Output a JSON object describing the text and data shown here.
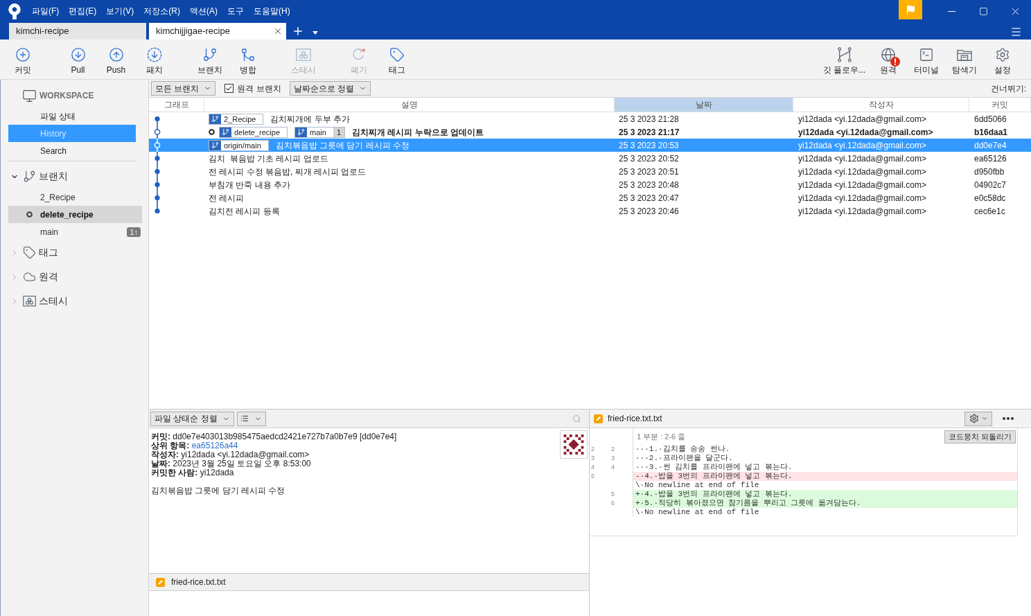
{
  "window": {
    "menu": [
      "파일(F)",
      "편집(E)",
      "보기(V)",
      "저장소(R)",
      "액션(A)",
      "도구",
      "도움말(H)"
    ]
  },
  "repo_tabs": [
    {
      "label": "kimchi-recipe",
      "selected": false
    },
    {
      "label": "kimchijjigae-recipe",
      "selected": true
    }
  ],
  "toolbar": {
    "left_groups": [
      {
        "buttons": [
          {
            "label": "커밋",
            "disabled": false
          }
        ]
      },
      {
        "buttons": [
          {
            "label": "Pull",
            "disabled": false
          },
          {
            "label": "Push",
            "disabled": false
          },
          {
            "label": "패치",
            "disabled": false
          }
        ]
      },
      {
        "buttons": [
          {
            "label": "브랜치",
            "disabled": false
          },
          {
            "label": "병합",
            "disabled": false
          }
        ]
      },
      {
        "buttons": [
          {
            "label": "스테시",
            "disabled": true
          }
        ]
      },
      {
        "buttons": [
          {
            "label": "폐기",
            "disabled": true
          },
          {
            "label": "태그",
            "disabled": false
          }
        ]
      }
    ],
    "right": [
      {
        "label": "깃 플로우...",
        "alert": false
      },
      {
        "label": "원격",
        "alert": true
      },
      {
        "label": "터미널",
        "alert": false
      },
      {
        "label": "탐색기",
        "alert": false
      },
      {
        "label": "설정",
        "alert": false
      }
    ]
  },
  "sidebar": {
    "workspace": {
      "label": "WORKSPACE",
      "items": [
        {
          "label": "파일 상태",
          "selected": false
        },
        {
          "label": "History",
          "selected": true
        },
        {
          "label": "Search",
          "selected": false
        }
      ]
    },
    "sections": [
      {
        "label": "브랜치",
        "expanded": true,
        "children": [
          {
            "label": "2_Recipe",
            "current": false,
            "selected": false
          },
          {
            "label": "delete_recipe",
            "current": true,
            "selected": true
          },
          {
            "label": "main",
            "current": false,
            "selected": false,
            "badge": "1↑"
          }
        ]
      },
      {
        "label": "태그",
        "expanded": false
      },
      {
        "label": "원격",
        "expanded": false
      },
      {
        "label": "스테시",
        "expanded": false
      }
    ]
  },
  "filter_bar": {
    "branch_filter": "모든 브랜치",
    "remote_branches": {
      "label": "원격 브랜치",
      "checked": true
    },
    "sort": "날짜순으로 정렬",
    "jump_label": "건너뛰기:"
  },
  "commit_table": {
    "columns": [
      {
        "label": "그래프",
        "sorted": false
      },
      {
        "label": "설명",
        "sorted": false
      },
      {
        "label": "날짜",
        "sorted": true
      },
      {
        "label": "작성자",
        "sorted": false
      },
      {
        "label": "커밋",
        "sorted": false
      }
    ],
    "rows": [
      {
        "kind": "dot",
        "head": false,
        "selected": false,
        "refs": [
          {
            "name": "2_Recipe",
            "checked_out": false
          }
        ],
        "description": "김치찌개에 두부 추가",
        "date": "25 3 2023 21:28",
        "author": "yi12dada <yi.12dada@gmail.com>",
        "commit": "6dd5066"
      },
      {
        "kind": "ring",
        "head": true,
        "selected": false,
        "refs": [
          {
            "name": "delete_recipe",
            "checked_out": true
          },
          {
            "name": "main",
            "checked_out": false,
            "ahead": "1"
          }
        ],
        "description": "김치찌개 레시피 누락으로 업데이트",
        "date": "25 3 2023 21:17",
        "author": "yi12dada <yi.12dada@gmail.com>",
        "commit": "b16daa1"
      },
      {
        "kind": "ring",
        "head": false,
        "selected": true,
        "refs": [
          {
            "name": "origin/main",
            "checked_out": false
          }
        ],
        "description": "김치볶음밥 그릇에 담기 레시피 수정",
        "date": "25 3 2023 20:53",
        "author": "yi12dada <yi.12dada@gmail.com>",
        "commit": "dd0e7e4"
      },
      {
        "kind": "dot",
        "head": false,
        "selected": false,
        "refs": [],
        "description": "김치  볶음밥 기초 레시피 업로드",
        "date": "25 3 2023 20:52",
        "author": "yi12dada <yi.12dada@gmail.com>",
        "commit": "ea65126"
      },
      {
        "kind": "dot",
        "head": false,
        "selected": false,
        "refs": [],
        "description": "전 레시피 수정 볶음밥, 찌개 레시피 업로드",
        "date": "25 3 2023 20:51",
        "author": "yi12dada <yi.12dada@gmail.com>",
        "commit": "d950fbb"
      },
      {
        "kind": "dot",
        "head": false,
        "selected": false,
        "refs": [],
        "description": "부침개 반죽 내용 추가",
        "date": "25 3 2023 20:48",
        "author": "yi12dada <yi.12dada@gmail.com>",
        "commit": "04902c7"
      },
      {
        "kind": "dot",
        "head": false,
        "selected": false,
        "refs": [],
        "description": "전 레시피",
        "date": "25 3 2023 20:47",
        "author": "yi12dada <yi.12dada@gmail.com>",
        "commit": "e0c58dc"
      },
      {
        "kind": "dot",
        "head": false,
        "selected": false,
        "refs": [],
        "description": "김치전 레시피 등록",
        "date": "25 3 2023 20:46",
        "author": "yi12dada <yi.12dada@gmail.com>",
        "commit": "cec6e1c"
      }
    ]
  },
  "details": {
    "sort": "파일 상태순 정렬",
    "fields": [
      {
        "label": "커밋:",
        "value": "dd0e7e403013b985475aedcd2421e727b7a0b7e9 [dd0e7e4]",
        "kind": "text"
      },
      {
        "label": "상위 항목:",
        "value": "ea65126a44",
        "kind": "link"
      },
      {
        "label": "작성자:",
        "value": "yi12dada <yi.12dada@gmail.com>",
        "kind": "text"
      },
      {
        "label": "날짜:",
        "value": "2023년 3월 25일 토요일 오후 8:53:00",
        "kind": "text"
      },
      {
        "label": "커밋한 사람:",
        "value": "yi12dada",
        "kind": "text"
      }
    ],
    "message": "김치볶음밥 그릇에 담기 레시피 수정",
    "files": [
      {
        "name": "fried-rice.txt.txt",
        "kind": "modified",
        "selected": true
      }
    ]
  },
  "diff": {
    "file": {
      "name": "fried-rice.txt.txt",
      "kind": "modified"
    },
    "hunk": {
      "title": "1 부분 : 2-6 줄",
      "action": "코드뭉치 되돌리기"
    },
    "lines": [
      {
        "kind": "context",
        "old": "2",
        "new": "2",
        "text": "···1.·김치를 송송 썬나."
      },
      {
        "kind": "context",
        "old": "3",
        "new": "3",
        "text": "···2.·프라이팬을 달군다."
      },
      {
        "kind": "context",
        "old": "4",
        "new": "4",
        "text": "···3.·썬 김치를 프라이팬에 넣고 볶는다."
      },
      {
        "kind": "removed",
        "old": "5",
        "text": "-·4.·밥을 3번의 프라이팬에 넣고 볶는다."
      },
      {
        "kind": "note",
        "text": "\\·No newline at end of file"
      },
      {
        "kind": "added",
        "new": "5",
        "text": "+·4.·밥을 3번의 프라이팬에 넣고 볶는다."
      },
      {
        "kind": "added",
        "new": "6",
        "text": "+·5.·적당히 볶아졌으면 참기름을 뿌리고 그릇에 옮겨담는다."
      },
      {
        "kind": "note",
        "text": "\\·No newline at end of file"
      }
    ]
  }
}
